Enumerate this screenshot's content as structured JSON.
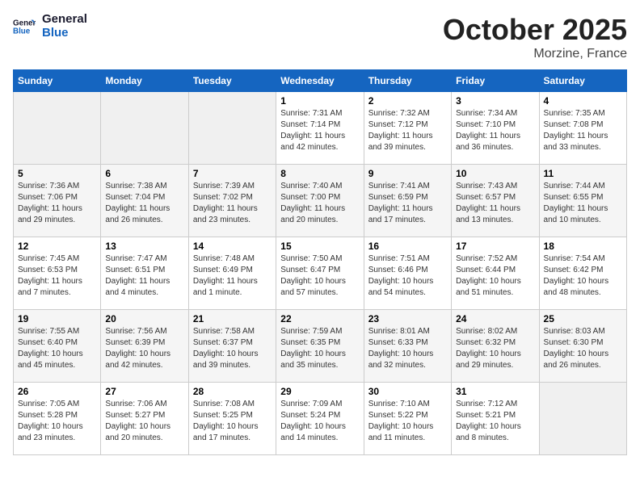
{
  "header": {
    "logo_text_general": "General",
    "logo_text_blue": "Blue",
    "month_title": "October 2025",
    "location": "Morzine, France"
  },
  "weekdays": [
    "Sunday",
    "Monday",
    "Tuesday",
    "Wednesday",
    "Thursday",
    "Friday",
    "Saturday"
  ],
  "weeks": [
    [
      {
        "day": "",
        "info": ""
      },
      {
        "day": "",
        "info": ""
      },
      {
        "day": "",
        "info": ""
      },
      {
        "day": "1",
        "info": "Sunrise: 7:31 AM\nSunset: 7:14 PM\nDaylight: 11 hours and 42 minutes."
      },
      {
        "day": "2",
        "info": "Sunrise: 7:32 AM\nSunset: 7:12 PM\nDaylight: 11 hours and 39 minutes."
      },
      {
        "day": "3",
        "info": "Sunrise: 7:34 AM\nSunset: 7:10 PM\nDaylight: 11 hours and 36 minutes."
      },
      {
        "day": "4",
        "info": "Sunrise: 7:35 AM\nSunset: 7:08 PM\nDaylight: 11 hours and 33 minutes."
      }
    ],
    [
      {
        "day": "5",
        "info": "Sunrise: 7:36 AM\nSunset: 7:06 PM\nDaylight: 11 hours and 29 minutes."
      },
      {
        "day": "6",
        "info": "Sunrise: 7:38 AM\nSunset: 7:04 PM\nDaylight: 11 hours and 26 minutes."
      },
      {
        "day": "7",
        "info": "Sunrise: 7:39 AM\nSunset: 7:02 PM\nDaylight: 11 hours and 23 minutes."
      },
      {
        "day": "8",
        "info": "Sunrise: 7:40 AM\nSunset: 7:00 PM\nDaylight: 11 hours and 20 minutes."
      },
      {
        "day": "9",
        "info": "Sunrise: 7:41 AM\nSunset: 6:59 PM\nDaylight: 11 hours and 17 minutes."
      },
      {
        "day": "10",
        "info": "Sunrise: 7:43 AM\nSunset: 6:57 PM\nDaylight: 11 hours and 13 minutes."
      },
      {
        "day": "11",
        "info": "Sunrise: 7:44 AM\nSunset: 6:55 PM\nDaylight: 11 hours and 10 minutes."
      }
    ],
    [
      {
        "day": "12",
        "info": "Sunrise: 7:45 AM\nSunset: 6:53 PM\nDaylight: 11 hours and 7 minutes."
      },
      {
        "day": "13",
        "info": "Sunrise: 7:47 AM\nSunset: 6:51 PM\nDaylight: 11 hours and 4 minutes."
      },
      {
        "day": "14",
        "info": "Sunrise: 7:48 AM\nSunset: 6:49 PM\nDaylight: 11 hours and 1 minute."
      },
      {
        "day": "15",
        "info": "Sunrise: 7:50 AM\nSunset: 6:47 PM\nDaylight: 10 hours and 57 minutes."
      },
      {
        "day": "16",
        "info": "Sunrise: 7:51 AM\nSunset: 6:46 PM\nDaylight: 10 hours and 54 minutes."
      },
      {
        "day": "17",
        "info": "Sunrise: 7:52 AM\nSunset: 6:44 PM\nDaylight: 10 hours and 51 minutes."
      },
      {
        "day": "18",
        "info": "Sunrise: 7:54 AM\nSunset: 6:42 PM\nDaylight: 10 hours and 48 minutes."
      }
    ],
    [
      {
        "day": "19",
        "info": "Sunrise: 7:55 AM\nSunset: 6:40 PM\nDaylight: 10 hours and 45 minutes."
      },
      {
        "day": "20",
        "info": "Sunrise: 7:56 AM\nSunset: 6:39 PM\nDaylight: 10 hours and 42 minutes."
      },
      {
        "day": "21",
        "info": "Sunrise: 7:58 AM\nSunset: 6:37 PM\nDaylight: 10 hours and 39 minutes."
      },
      {
        "day": "22",
        "info": "Sunrise: 7:59 AM\nSunset: 6:35 PM\nDaylight: 10 hours and 35 minutes."
      },
      {
        "day": "23",
        "info": "Sunrise: 8:01 AM\nSunset: 6:33 PM\nDaylight: 10 hours and 32 minutes."
      },
      {
        "day": "24",
        "info": "Sunrise: 8:02 AM\nSunset: 6:32 PM\nDaylight: 10 hours and 29 minutes."
      },
      {
        "day": "25",
        "info": "Sunrise: 8:03 AM\nSunset: 6:30 PM\nDaylight: 10 hours and 26 minutes."
      }
    ],
    [
      {
        "day": "26",
        "info": "Sunrise: 7:05 AM\nSunset: 5:28 PM\nDaylight: 10 hours and 23 minutes."
      },
      {
        "day": "27",
        "info": "Sunrise: 7:06 AM\nSunset: 5:27 PM\nDaylight: 10 hours and 20 minutes."
      },
      {
        "day": "28",
        "info": "Sunrise: 7:08 AM\nSunset: 5:25 PM\nDaylight: 10 hours and 17 minutes."
      },
      {
        "day": "29",
        "info": "Sunrise: 7:09 AM\nSunset: 5:24 PM\nDaylight: 10 hours and 14 minutes."
      },
      {
        "day": "30",
        "info": "Sunrise: 7:10 AM\nSunset: 5:22 PM\nDaylight: 10 hours and 11 minutes."
      },
      {
        "day": "31",
        "info": "Sunrise: 7:12 AM\nSunset: 5:21 PM\nDaylight: 10 hours and 8 minutes."
      },
      {
        "day": "",
        "info": ""
      }
    ]
  ]
}
